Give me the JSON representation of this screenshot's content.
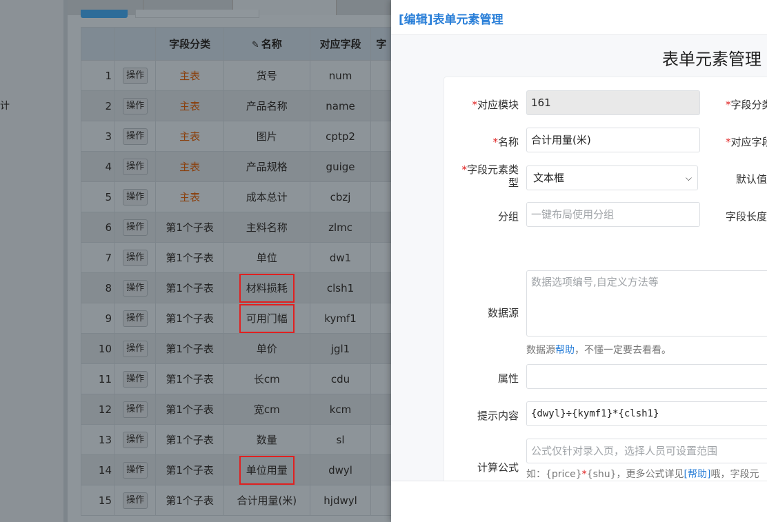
{
  "background": {
    "sidebar_fragment": "计",
    "table": {
      "headers": [
        "",
        "",
        "字段分类",
        "名称",
        "对应字段",
        "字"
      ],
      "op_label": "操作",
      "rows": [
        {
          "no": "1",
          "category": "主表",
          "name": "货号",
          "field": "num",
          "is_main": true
        },
        {
          "no": "2",
          "category": "主表",
          "name": "产品名称",
          "field": "name",
          "is_main": true
        },
        {
          "no": "3",
          "category": "主表",
          "name": "图片",
          "field": "cptp2",
          "is_main": true
        },
        {
          "no": "4",
          "category": "主表",
          "name": "产品规格",
          "field": "guige",
          "is_main": true
        },
        {
          "no": "5",
          "category": "主表",
          "name": "成本总计",
          "field": "cbzj",
          "is_main": true
        },
        {
          "no": "6",
          "category": "第1个子表",
          "name": "主料名称",
          "field": "zlmc",
          "is_main": false
        },
        {
          "no": "7",
          "category": "第1个子表",
          "name": "单位",
          "field": "dw1",
          "is_main": false
        },
        {
          "no": "8",
          "category": "第1个子表",
          "name": "材料损耗",
          "field": "clsh1",
          "is_main": false,
          "highlighted": true
        },
        {
          "no": "9",
          "category": "第1个子表",
          "name": "可用门幅",
          "field": "kymf1",
          "is_main": false,
          "highlighted": true
        },
        {
          "no": "10",
          "category": "第1个子表",
          "name": "单价",
          "field": "jgl1",
          "is_main": false
        },
        {
          "no": "11",
          "category": "第1个子表",
          "name": "长cm",
          "field": "cdu",
          "is_main": false
        },
        {
          "no": "12",
          "category": "第1个子表",
          "name": "宽cm",
          "field": "kcm",
          "is_main": false
        },
        {
          "no": "13",
          "category": "第1个子表",
          "name": "数量",
          "field": "sl",
          "is_main": false
        },
        {
          "no": "14",
          "category": "第1个子表",
          "name": "单位用量",
          "field": "dwyl",
          "is_main": false,
          "highlighted": true
        },
        {
          "no": "15",
          "category": "第1个子表",
          "name": "合计用量(米)",
          "field": "hjdwyl",
          "is_main": false
        }
      ]
    }
  },
  "panel": {
    "title": "[编辑]表单元素管理",
    "heading": "表单元素管理",
    "required_mark": "*",
    "fields": {
      "module": {
        "label": "对应模块",
        "value": "161"
      },
      "name": {
        "label": "名称",
        "value": "合计用量(米)"
      },
      "element_type": {
        "label_line1": "字段元素类",
        "label_line2": "型",
        "value": "文本框"
      },
      "group": {
        "label": "分组",
        "placeholder": "一键布局使用分组"
      },
      "datasource": {
        "label": "数据源",
        "placeholder": "数据选项编号,自定义方法等",
        "help_prefix": "数据源",
        "help_link": "帮助",
        "help_suffix": "，不懂一定要去看看。"
      },
      "attribute": {
        "label": "属性",
        "value": ""
      },
      "tip": {
        "label": "提示内容",
        "value": "{dwyl}÷{kymf1}*{clsh1}"
      },
      "formula": {
        "label": "计算公式",
        "placeholder": "公式仅针对录入页，选择人员可设置范围",
        "hint_prefix": "如：{price}",
        "hint_star": "*",
        "hint_mid": "{shu}，更多公式详见",
        "hint_link": "[帮助]",
        "hint_suffix": "哦，字段元"
      }
    },
    "right_labels": {
      "category": "字段分类",
      "field": "对应字段",
      "default": "默认值",
      "length": "字段长度"
    }
  },
  "colors": {
    "accent": "#2a7fd8",
    "required": "#e02020",
    "main_table_text": "#8a3f0c",
    "highlight_box": "#e02020"
  }
}
